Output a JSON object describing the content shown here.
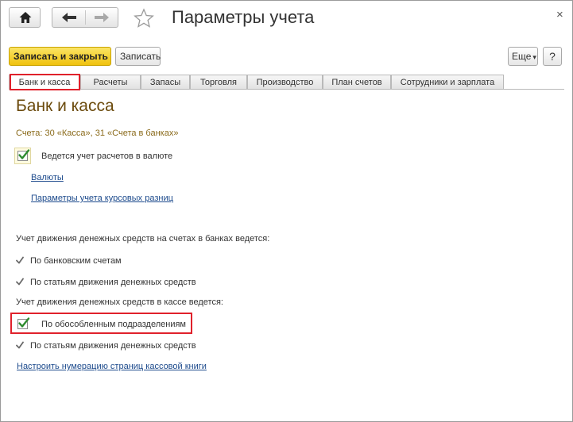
{
  "window": {
    "title": "Параметры учета",
    "close_glyph": "×"
  },
  "toolbar": {
    "save_close_label": "Записать и закрыть",
    "save_label": "Записать",
    "more_label": "Еще",
    "more_arrow": "▾",
    "help_label": "?"
  },
  "tabs": [
    {
      "label": "Банк и касса",
      "active": true
    },
    {
      "label": "Расчеты"
    },
    {
      "label": "Запасы"
    },
    {
      "label": "Торговля"
    },
    {
      "label": "Производство"
    },
    {
      "label": "План счетов"
    },
    {
      "label": "Сотрудники и зарплата"
    }
  ],
  "content": {
    "heading": "Банк и касса",
    "accounts_note": "Счета: 30 «Касса», 31 «Счета в банках»",
    "currency": {
      "checked": true,
      "label": "Ведется учет расчетов в валюте",
      "links": [
        "Валюты",
        "Параметры учета курсовых разниц"
      ]
    },
    "bank_section": {
      "heading": "Учет движения денежных средств на счетах в банках ведется:",
      "items": [
        "По банковским счетам",
        "По статьям движения денежных средств"
      ]
    },
    "cash_section": {
      "heading": "Учет движения денежных средств в кассе ведется:",
      "subdivisions_label": "По обособленным подразделениям",
      "subdivisions_checked": true,
      "items": [
        "По статьям движения денежных средств"
      ]
    },
    "cash_book_link": "Настроить нумерацию страниц кассовой книги"
  },
  "colors": {
    "accent_yellow": "#f0c20e",
    "heading_brown": "#6b4a0c",
    "link_blue": "#1c4a8c",
    "highlight_red": "#e0212b",
    "check_green": "#2e8b2e"
  }
}
